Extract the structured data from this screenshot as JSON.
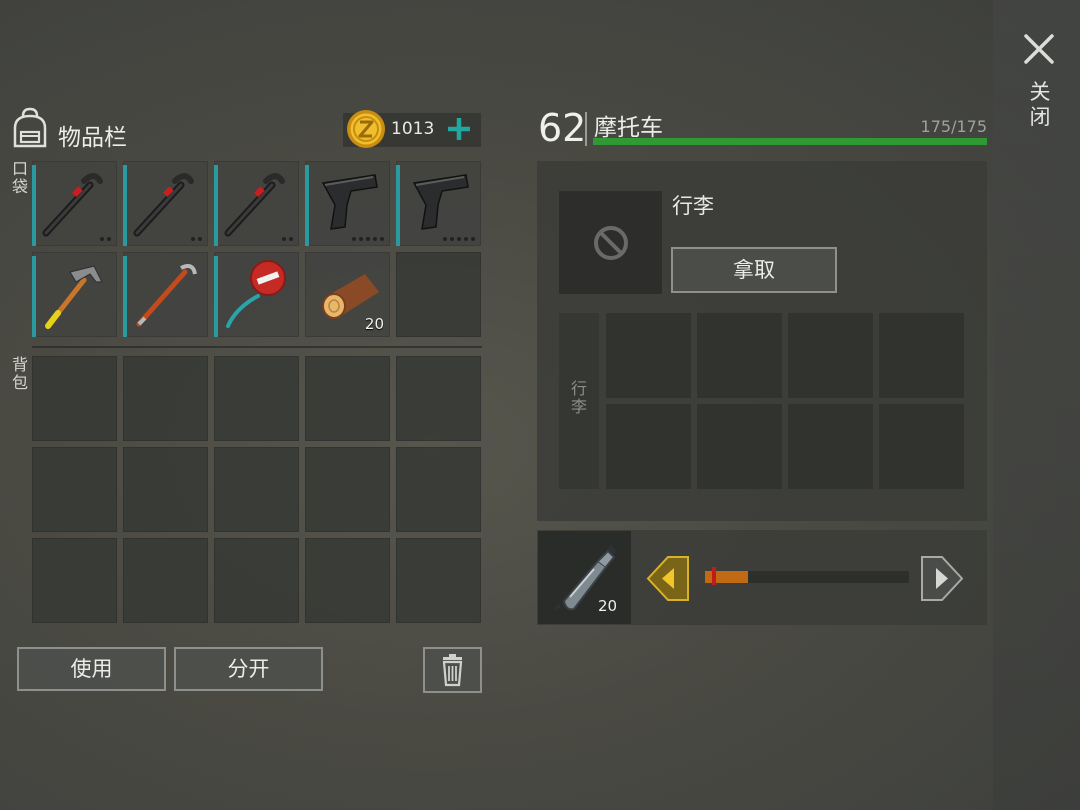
{
  "close": {
    "icon": "close-icon",
    "label": "关闭"
  },
  "inventory": {
    "title": "物品栏",
    "icon": "backpack-icon",
    "coins": {
      "icon": "coin-icon",
      "value": "1013",
      "add_icon": "plus-icon"
    },
    "pocket_label": "口袋",
    "backpack_label": "背包",
    "pocket_slots": [
      {
        "item": "crowbar-icon",
        "dots": 2,
        "durability": 0.95
      },
      {
        "item": "crowbar-icon",
        "dots": 2,
        "durability": 0.95
      },
      {
        "item": "crowbar-icon",
        "dots": 2,
        "durability": 0.95
      },
      {
        "item": "pistol-icon",
        "dots": 5,
        "durability": 0.95
      },
      {
        "item": "pistol-icon",
        "dots": 5,
        "durability": 0.95
      },
      {
        "item": "hammer-icon",
        "durability": 0.95
      },
      {
        "item": "pry-bar-icon",
        "durability": 0.95
      },
      {
        "item": "stop-sign-icon",
        "durability": 0.95
      },
      {
        "item": "log-icon",
        "quantity": "20"
      },
      {
        "item": ""
      }
    ],
    "backpack_slots": 15,
    "buttons": {
      "use": "使用",
      "split": "分开",
      "trash_icon": "trash-icon"
    }
  },
  "vehicle": {
    "level": "62",
    "name": "摩托车",
    "hp_text": "175/175",
    "hp_fraction": 1.0,
    "hp_color": "#2f9a34",
    "luggage": {
      "title": "行李",
      "empty_icon": "no-entry-icon",
      "take_button": "拿取",
      "side_label": "行李",
      "slots": 8
    },
    "fuel": {
      "item_icon": "water-bottle-icon",
      "quantity": "20",
      "slider_fraction": 0.21,
      "slider_color": "#c06a14",
      "left_icon": "arrow-left-icon",
      "right_icon": "arrow-right-icon"
    }
  }
}
